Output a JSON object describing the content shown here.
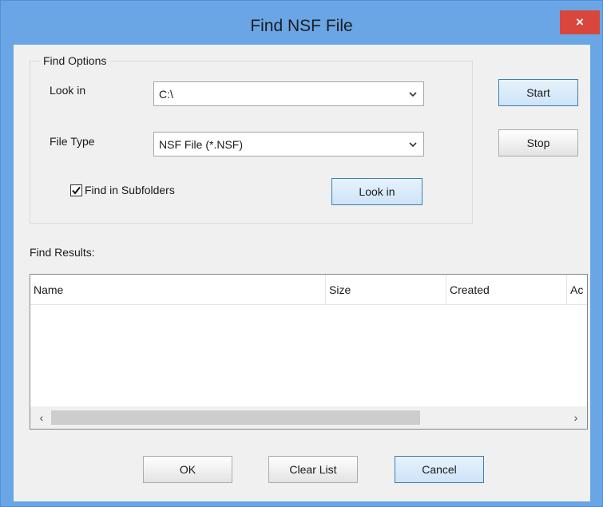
{
  "window": {
    "title": "Find NSF File",
    "close_label": "×"
  },
  "find_options": {
    "legend": "Find Options",
    "look_in_label": "Look in",
    "look_in_value": "C:\\",
    "file_type_label": "File Type",
    "file_type_value": "NSF File (*.NSF)",
    "subfolders_label": "Find in Subfolders",
    "subfolders_checked": true,
    "look_in_button": "Look in"
  },
  "actions": {
    "start": "Start",
    "stop": "Stop"
  },
  "results": {
    "label": "Find Results:",
    "columns": [
      "Name",
      "Size",
      "Created",
      "Ac"
    ],
    "rows": []
  },
  "footer": {
    "ok": "OK",
    "clear_list": "Clear List",
    "cancel": "Cancel"
  },
  "icons": {
    "close": "close-icon",
    "dropdown": "chevron-down-icon",
    "check": "checkmark-icon",
    "scroll_left": "scroll-left-icon",
    "scroll_right": "scroll-right-icon"
  },
  "colors": {
    "titlebar": "#6aa6e6",
    "close_button": "#d9463b",
    "client": "#f0f0f0",
    "default_button_border": "#3c7fb1"
  }
}
